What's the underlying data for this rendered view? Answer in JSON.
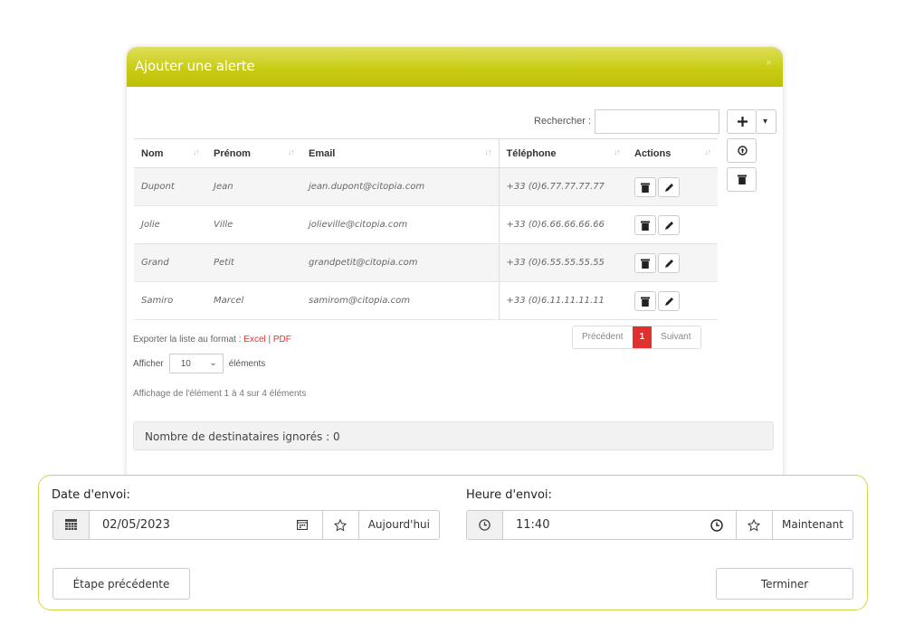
{
  "modal": {
    "title": "Ajouter une alerte",
    "close": "×",
    "search_label": "Rechercher :",
    "search_value": "",
    "columns": [
      "Nom",
      "Prénom",
      "Email",
      "Téléphone",
      "Actions"
    ],
    "rows": [
      {
        "nom": "Dupont",
        "prenom": "Jean",
        "email": "jean.dupont@citopia.com",
        "tel": "+33 (0)6.77.77.77.77"
      },
      {
        "nom": "Jolie",
        "prenom": "Ville",
        "email": "jolieville@citopia.com",
        "tel": "+33 (0)6.66.66.66.66"
      },
      {
        "nom": "Grand",
        "prenom": "Petit",
        "email": "grandpetit@citopia.com",
        "tel": "+33 (0)6.55.55.55.55"
      },
      {
        "nom": "Samiro",
        "prenom": "Marcel",
        "email": "samirom@citopia.com",
        "tel": "+33 (0)6.11.11.11.11"
      }
    ],
    "export_text": "Exporter la liste au format : ",
    "export_excel": "Excel",
    "export_sep": " | ",
    "export_pdf": "PDF",
    "pager": {
      "prev": "Précédent",
      "current": "1",
      "next": "Suivant"
    },
    "show_prefix": "Afficher",
    "show_value": "10",
    "show_suffix": "éléments",
    "info": "Affichage de l'élément 1 à 4 sur 4 éléments",
    "ignored": "Nombre de destinataires ignorés : 0"
  },
  "panel": {
    "date_label": "Date d'envoi:",
    "date_value": "02/05/2023",
    "today_label": "Aujourd'hui",
    "time_label": "Heure d'envoi:",
    "time_value": "11:40",
    "now_label": "Maintenant",
    "prev_button": "Étape précédente",
    "finish_button": "Terminer"
  },
  "icons": {
    "add": "plus-icon",
    "caret": "caret-down-icon",
    "upload": "upload-circle-icon",
    "trash": "trash-icon",
    "edit": "pencil-icon",
    "calendar": "calendar-icon",
    "clock": "clock-icon",
    "star": "star-icon"
  },
  "colors": {
    "header_accent": "#c9cc12",
    "pager_active": "#e1312f",
    "export_link": "#e1312f",
    "panel_border": "#d4d64a"
  }
}
